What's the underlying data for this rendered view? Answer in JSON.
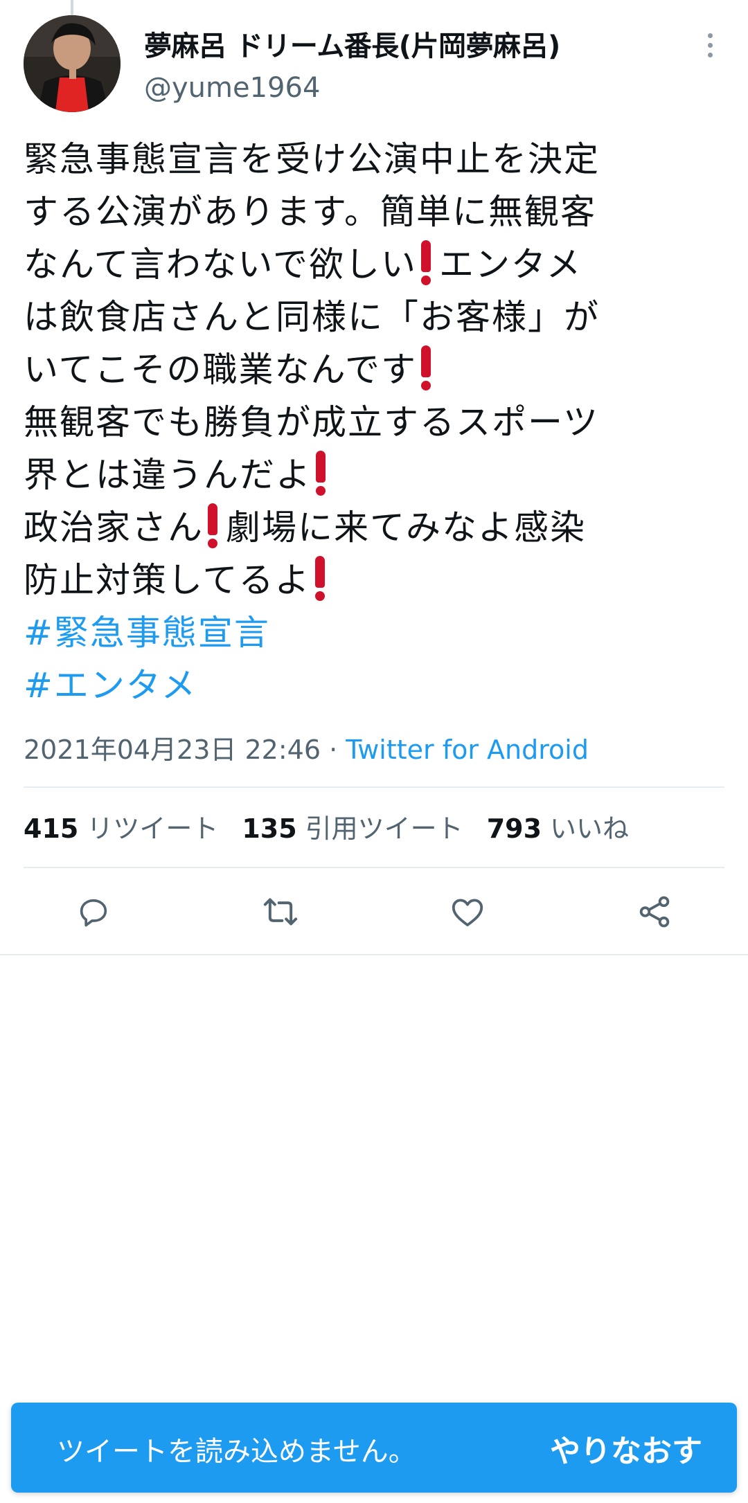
{
  "tweet": {
    "author": {
      "display_name": "夢麻呂 ドリーム番長(片岡夢麻呂)",
      "handle": "@yume1964"
    },
    "body_lines": [
      "緊急事態宣言を受け公演中止を決定",
      "する公演があります。簡単に無観客",
      "なんて言わないで欲しい",
      "エンタメ",
      "は飲食店さんと同様に「お客様」が",
      "いてこその職業なんです",
      "無観客でも勝負が成立するスポーツ",
      "界とは違うんだよ",
      "政治家さん",
      "劇場に来てみなよ感染",
      "防止対策してるよ"
    ],
    "hashtags": [
      "#緊急事態宣言",
      "#エンタメ"
    ],
    "timestamp": "2021年04月23日 22:46",
    "separator": " · ",
    "source": "Twitter for Android",
    "stats": {
      "retweets": {
        "count": "415",
        "label": "リツイート"
      },
      "quotes": {
        "count": "135",
        "label": "引用ツイート"
      },
      "likes": {
        "count": "793",
        "label": "いいね"
      }
    },
    "actions": [
      "reply-icon",
      "retweet-icon",
      "like-icon",
      "share-icon"
    ],
    "emoji": "heavy-exclamation-mark"
  },
  "toast": {
    "message": "ツイートを読み込めません。",
    "retry_label": "やりなおす"
  },
  "colors": {
    "accent": "#1d9bf0",
    "text": "#0f1419",
    "secondary_text": "#536471",
    "divider": "#e6ecf0",
    "exclamation": "#d0112b"
  }
}
